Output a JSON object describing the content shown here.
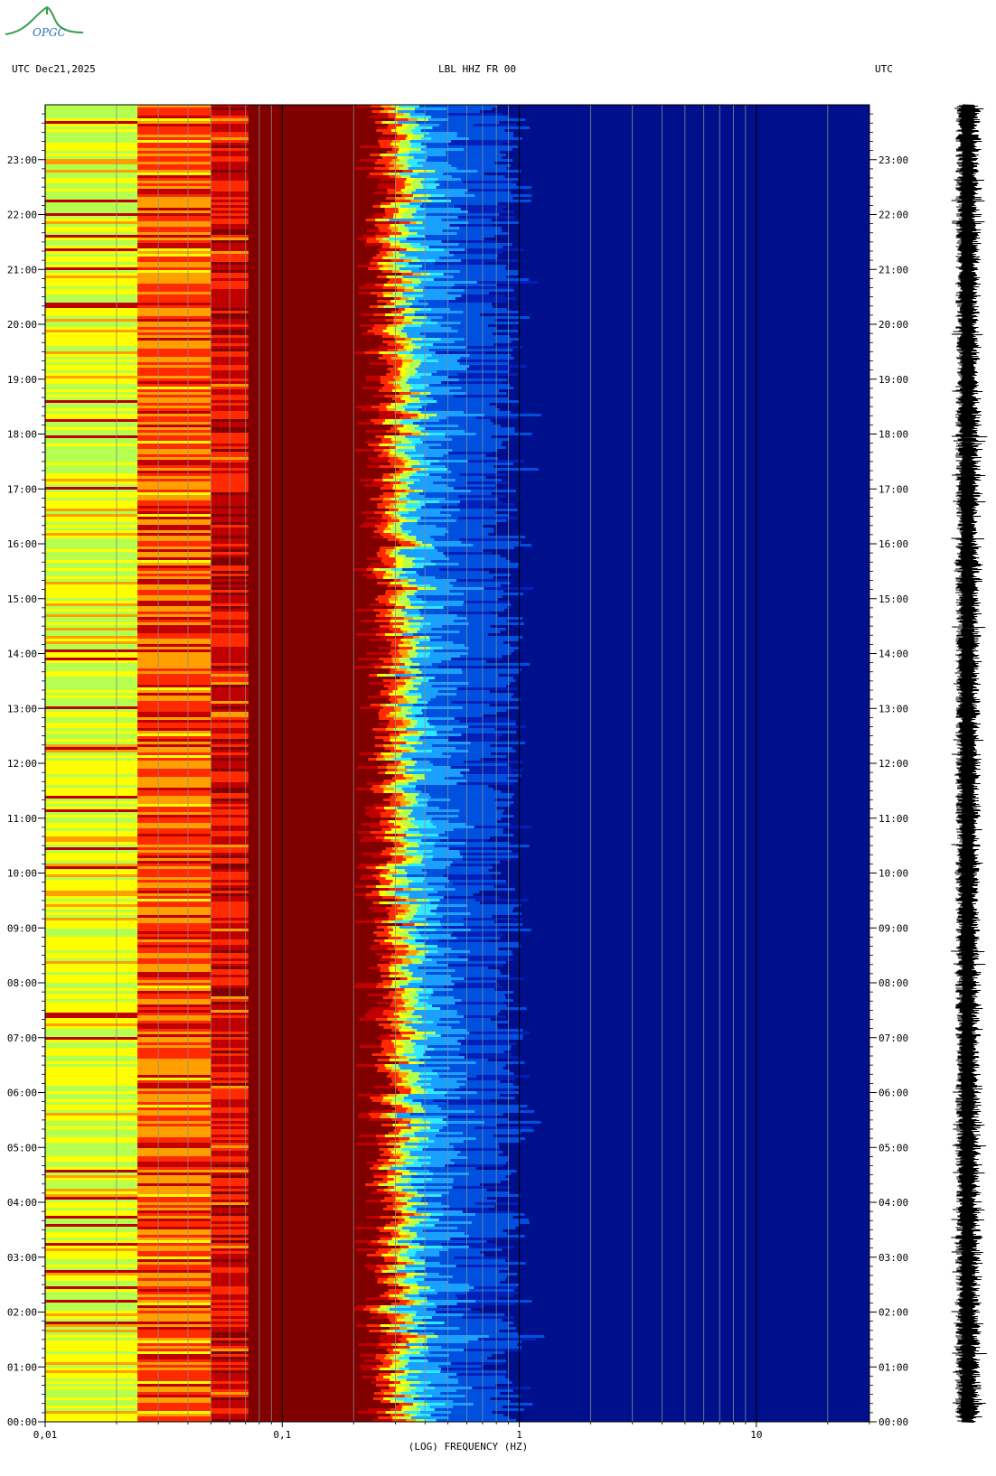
{
  "header": {
    "left": "UTC  Dec21,2025",
    "center": "LBL HHZ FR 00",
    "right": "UTC"
  },
  "logo": {
    "text": "OPGC",
    "color": "#3aa04a"
  },
  "colors": {
    "palette": [
      "#00108c",
      "#0020b8",
      "#0050e0",
      "#1aa0ff",
      "#30e8ff",
      "#b4ff50",
      "#ffff00",
      "#ffa000",
      "#ff2a00",
      "#c00000",
      "#800000"
    ],
    "grid_line": "#8a8a8a",
    "decade_line": "#000000"
  },
  "chart_data": {
    "type": "heatmap",
    "xlabel": "(LOG) FREQUENCY (HZ)",
    "x_scale": "log",
    "xlim": [
      0.01,
      30
    ],
    "x_ticks": [
      0.01,
      0.1,
      1,
      10
    ],
    "x_tick_labels": [
      "0,01",
      "0,1",
      "1",
      "10"
    ],
    "ylim_hours_utc": [
      0,
      24
    ],
    "y_ticks": [
      "00:00",
      "01:00",
      "02:00",
      "03:00",
      "04:00",
      "05:00",
      "06:00",
      "07:00",
      "08:00",
      "09:00",
      "10:00",
      "11:00",
      "12:00",
      "13:00",
      "14:00",
      "15:00",
      "16:00",
      "17:00",
      "18:00",
      "19:00",
      "20:00",
      "21:00",
      "22:00",
      "23:00"
    ],
    "y_label_left": "UTC",
    "y_label_right": "UTC",
    "grid": true,
    "frequency_bands": [
      {
        "from": 0.01,
        "to": 0.024,
        "level": "yellow-green to cyan"
      },
      {
        "from": 0.024,
        "to": 0.05,
        "level": "orange-red"
      },
      {
        "from": 0.05,
        "to": 0.07,
        "level": "red to dark red"
      },
      {
        "from": 0.07,
        "to": 0.2,
        "level": "dark red (maximum)"
      },
      {
        "from": 0.2,
        "to": 0.3,
        "level": "dark red to orange"
      },
      {
        "from": 0.3,
        "to": 0.45,
        "level": "yellow to cyan"
      },
      {
        "from": 0.45,
        "to": 0.8,
        "level": "light blue"
      },
      {
        "from": 0.8,
        "to": 30,
        "level": "dark blue (minimum)"
      }
    ],
    "side_trace": "seismogram"
  }
}
